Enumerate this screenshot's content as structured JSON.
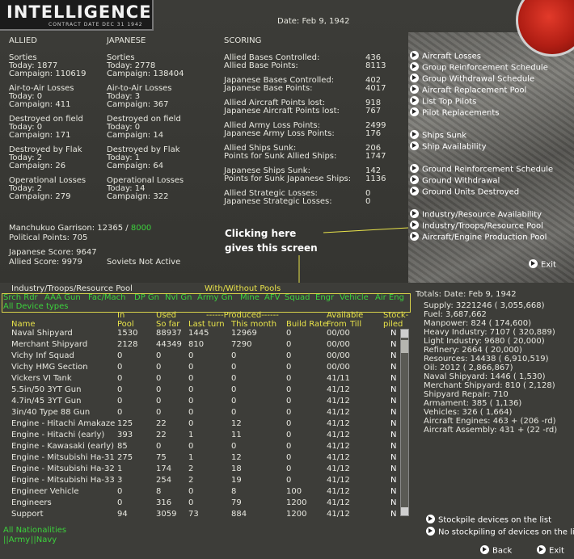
{
  "header": {
    "logo_title": "INTELLIGENCE",
    "logo_sub": "CONTRACT DATE DEC 31 1942",
    "date": "Date: Feb 9, 1942"
  },
  "allied": {
    "heading": "ALLIED",
    "blocks": [
      {
        "title": "Sorties",
        "today": "Today:    1877",
        "campaign": "Campaign: 110619"
      },
      {
        "title": "Air-to-Air Losses",
        "today": "Today:    0",
        "campaign": "Campaign: 411"
      },
      {
        "title": "Destroyed on field",
        "today": "Today:    0",
        "campaign": "Campaign: 171"
      },
      {
        "title": "Destroyed by Flak",
        "today": "Today:    2",
        "campaign": "Campaign: 26"
      },
      {
        "title": "Operational Losses",
        "today": "Today:    2",
        "campaign": "Campaign: 279"
      }
    ]
  },
  "japanese": {
    "heading": "JAPANESE",
    "blocks": [
      {
        "title": "Sorties",
        "today": "Today:    2778",
        "campaign": "Campaign: 138404"
      },
      {
        "title": "Air-to-Air Losses",
        "today": "Today:    3",
        "campaign": "Campaign: 367"
      },
      {
        "title": "Destroyed on field",
        "today": "Today:    0",
        "campaign": "Campaign: 14"
      },
      {
        "title": "Destroyed by Flak",
        "today": "Today:    1",
        "campaign": "Campaign: 64"
      },
      {
        "title": "Operational Losses",
        "today": "Today:    14",
        "campaign": "Campaign: 322"
      }
    ]
  },
  "scoring": {
    "heading": "SCORING",
    "groups": [
      [
        {
          "label": "Allied Bases Controlled:",
          "value": "436"
        },
        {
          "label": "Allied Base Points:",
          "value": "8113"
        }
      ],
      [
        {
          "label": "Japanese Bases Controlled:",
          "value": "402"
        },
        {
          "label": "Japanese Base Points:",
          "value": "4017"
        }
      ],
      [
        {
          "label": "Allied Aircraft Points lost:",
          "value": "918"
        },
        {
          "label": "Japanese Aircraft Points lost:",
          "value": "767"
        }
      ],
      [
        {
          "label": "Allied Army Loss Points:",
          "value": "2499"
        },
        {
          "label": "Japanese Army Loss Points:",
          "value": "176"
        }
      ],
      [
        {
          "label": "Allied Ships Sunk:",
          "value": "206"
        },
        {
          "label": "Points for Sunk Allied Ships:",
          "value": "1747"
        }
      ],
      [
        {
          "label": "Japanese Ships Sunk:",
          "value": "142"
        },
        {
          "label": "Points for Sunk Japanese Ships:",
          "value": "1136"
        }
      ],
      [
        {
          "label": "Allied Strategic Losses:",
          "value": "0"
        },
        {
          "label": "Japanese Strategic Losses:",
          "value": "0"
        }
      ]
    ]
  },
  "misc": {
    "garrison_label": "Manchukuo Garrison: 12365 / ",
    "garrison_value": "8000",
    "political": "Political Points: 705",
    "japanese_score": "Japanese Score: 9647",
    "allied_score": "Allied Score: 9979",
    "soviets": "Soviets Not Active"
  },
  "menu": [
    "Aircraft Losses",
    "Group Reinforcement Schedule",
    "Group Withdrawal Schedule",
    "Aircraft Replacement Pool",
    "List Top Pilots",
    "Pilot Replacements",
    "Ships Sunk",
    "Ship Availability",
    "Ground Reinforcement Schedule",
    "Ground Withdrawal",
    "Ground Units Destroyed",
    "Industry/Resource Availability",
    "Industry/Troops/Resource Pool",
    "Aircraft/Engine Production Pool",
    "Exit"
  ],
  "callout": {
    "line1": "Clicking here",
    "line2": "gives this screen"
  },
  "pool": {
    "title": "Industry/Troops/Resource Pool",
    "with_without": "With/Without Pools",
    "filters": [
      "Srch Rdr",
      "AAA Gun",
      "Fac/Mach",
      "DP Gn",
      "Nvl Gn",
      "Army Gn",
      "Mine",
      "AFV",
      "Squad",
      "Engr",
      "Vehicle",
      "Air Eng"
    ],
    "all_device": "All Device types",
    "headers": {
      "name": "Name",
      "in": "In",
      "pool": "Pool",
      "used": "Used",
      "sofar": "So far",
      "produced": "------Produced------",
      "last": "Last turn",
      "month": "This month",
      "build": "Build Rate",
      "avail": "Available",
      "from": "From",
      "till": "Till",
      "stock1": "Stock-",
      "stock2": "piled"
    },
    "rows": [
      [
        "Naval Shipyard",
        "1530",
        "88937",
        "1445",
        "12969",
        "0",
        "00/00",
        "N"
      ],
      [
        "Merchant Shipyard",
        "2128",
        "44349",
        "810",
        "7290",
        "0",
        "00/00",
        "N"
      ],
      [
        "Vichy Inf Squad",
        "0",
        "0",
        "0",
        "0",
        "0",
        "00/00",
        "N"
      ],
      [
        "Vichy HMG Section",
        "0",
        "0",
        "0",
        "0",
        "0",
        "00/00",
        "N"
      ],
      [
        "Vickers VI Tank",
        "0",
        "0",
        "0",
        "0",
        "0",
        "41/11",
        "N"
      ],
      [
        "5.5in/50 3YT Gun",
        "0",
        "0",
        "0",
        "0",
        "0",
        "41/12",
        "N"
      ],
      [
        "4.7in/45 3YT Gun",
        "0",
        "0",
        "0",
        "0",
        "0",
        "41/12",
        "N"
      ],
      [
        "3in/40 Type 88 Gun",
        "0",
        "0",
        "0",
        "0",
        "0",
        "41/12",
        "N"
      ],
      [
        "Engine - Hitachi Amakaze",
        "125",
        "22",
        "0",
        "12",
        "0",
        "41/12",
        "N"
      ],
      [
        "Engine - Hitachi (early)",
        "393",
        "22",
        "1",
        "11",
        "0",
        "41/12",
        "N"
      ],
      [
        "Engine - Kawasaki (early)",
        "85",
        "0",
        "0",
        "0",
        "0",
        "41/12",
        "N"
      ],
      [
        "Engine - Mitsubishi Ha-31",
        "275",
        "75",
        "1",
        "12",
        "0",
        "41/12",
        "N"
      ],
      [
        "Engine - Mitsubishi Ha-32",
        "1",
        "174",
        "2",
        "18",
        "0",
        "41/12",
        "N"
      ],
      [
        "Engine - Mitsubishi Ha-33",
        "3",
        "254",
        "2",
        "19",
        "0",
        "41/12",
        "N"
      ],
      [
        "Engineer Vehicle",
        "0",
        "8",
        "0",
        "8",
        "100",
        "41/12",
        "N"
      ],
      [
        "Engineers",
        "0",
        "316",
        "0",
        "79",
        "1200",
        "41/12",
        "N"
      ],
      [
        "Support",
        "94",
        "3059",
        "73",
        "884",
        "1200",
        "41/12",
        "N"
      ]
    ],
    "all_nationalities": "All Nationalities",
    "army": "||Army",
    "navy": "||Navy"
  },
  "totals": {
    "heading": "Totals:  Date: Feb 9, 1942",
    "lines": [
      "Supply: 3221246 ( 3,055,668)",
      "Fuel: 3,687,662",
      "Manpower: 824 ( 174,600)",
      "Heavy Industry: 7107 ( 320,889)",
      "Light Industry: 9680 ( 20,000)",
      "Refinery: 2664 ( 20,000)",
      "Resources: 14438 ( 6,910,519)",
      "Oil: 2012 ( 2,866,867)",
      "Naval Shipyard: 1446 ( 1,530)",
      "Merchant Shipyard: 810 ( 2,128)",
      "Shipyard Repair: 710",
      "Armament: 385 ( 1,136)",
      "Vehicles: 326 ( 1,664)",
      "Aircraft Engines: 463 + (206 -rd)",
      "Aircraft Assembly: 431 + (22 -rd)"
    ]
  },
  "bottom_menu": {
    "stockpile": "Stockpile devices on the list",
    "no_stockpile": "No stockpiling of devices on the list",
    "back": "Back",
    "exit": "Exit"
  }
}
